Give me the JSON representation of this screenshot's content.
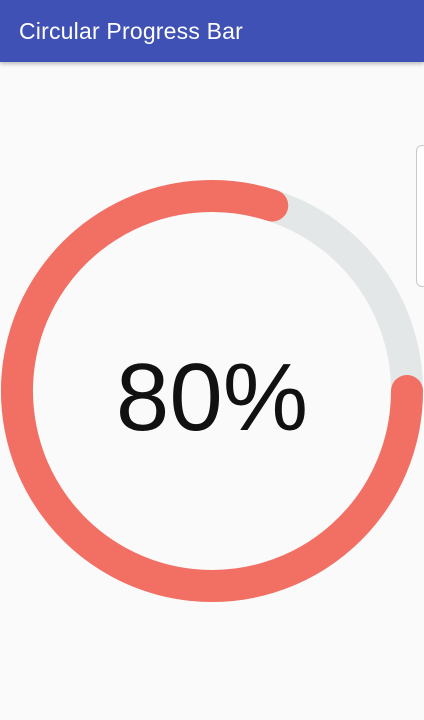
{
  "app_bar": {
    "title": "Circular Progress Bar",
    "color": "#3f51b5"
  },
  "progress": {
    "value": 0.8,
    "label": "80%",
    "progress_color": "#f26f63",
    "track_color": "#e3e7e8"
  }
}
